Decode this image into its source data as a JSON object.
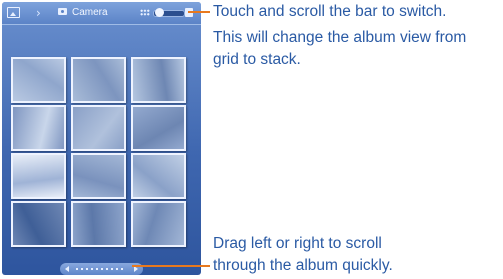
{
  "topbar": {
    "album_title": "Camera",
    "icons": [
      "gallery-icon",
      "camera-icon",
      "grid-view-icon",
      "stack-view-icon"
    ]
  },
  "view_switch": {
    "current": "grid"
  },
  "thumbnails": [
    {
      "color_a": "#b9c9e2",
      "color_b": "#8fa6cc"
    },
    {
      "color_a": "#a9bcd8",
      "color_b": "#7d95bf"
    },
    {
      "color_a": "#b4c6e0",
      "color_b": "#6e87b3"
    },
    {
      "color_a": "#7f96c1",
      "color_b": "#c9d6ea"
    },
    {
      "color_a": "#8aa0c7",
      "color_b": "#b0c1dc"
    },
    {
      "color_a": "#93a9cf",
      "color_b": "#6d86b2"
    },
    {
      "color_a": "#e8eef8",
      "color_b": "#9fb3d6"
    },
    {
      "color_a": "#a3b7d6",
      "color_b": "#7a92bd"
    },
    {
      "color_a": "#c0cfe5",
      "color_b": "#8aa1c8"
    },
    {
      "color_a": "#6e87b4",
      "color_b": "#3f5f97"
    },
    {
      "color_a": "#8ca3ca",
      "color_b": "#5c78a9"
    },
    {
      "color_a": "#a2b6d6",
      "color_b": "#6e88b5"
    }
  ],
  "callouts": {
    "switch_line1": "Touch and scroll the bar to switch.",
    "switch_line2": "This will change the album view from",
    "switch_line3": "grid to stack.",
    "scroll_line1": "Drag left or right to scroll",
    "scroll_line2": "through the album quickly."
  },
  "colors": {
    "callout_text": "#2a5aa4",
    "callout_line": "#e8791e",
    "phone_bg": "#3f67b0"
  }
}
